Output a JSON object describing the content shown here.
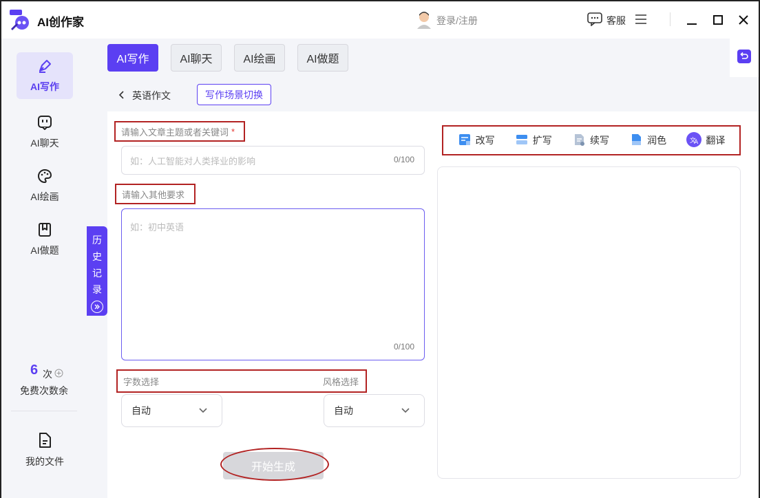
{
  "app": {
    "title": "AI创作家",
    "login": "登录/注册",
    "service": "客服"
  },
  "colors": {
    "accent": "#5b3ff2",
    "highlight": "#b22222"
  },
  "sidebar": {
    "items": [
      {
        "label": "AI写作",
        "icon": "pen-icon",
        "active": true
      },
      {
        "label": "AI聊天",
        "icon": "chat-bot-icon"
      },
      {
        "label": "AI绘画",
        "icon": "palette-icon"
      },
      {
        "label": "AI做题",
        "icon": "bookmark-book-icon"
      }
    ],
    "free_count": "6",
    "free_unit": "次",
    "free_label": "免费次数余",
    "my_files": "我的文件"
  },
  "tabs": [
    "AI写作",
    "AI聊天",
    "AI绘画",
    "AI做题"
  ],
  "crumb": {
    "back": "英语作文",
    "switch": "写作场景切换"
  },
  "history": [
    "历",
    "史",
    "记",
    "录"
  ],
  "form": {
    "topic_label": "请输入文章主题或者关键词",
    "required_mark": "*",
    "topic_placeholder": "如：人工智能对人类择业的影响",
    "topic_counter": "0/100",
    "other_label": "请输入其他要求",
    "other_placeholder": "如：初中英语",
    "other_counter": "0/100",
    "word_label": "字数选择",
    "style_label": "风格选择",
    "word_value": "自动",
    "style_value": "自动",
    "generate": "开始生成"
  },
  "tools": [
    {
      "label": "改写",
      "icon": "rewrite-icon"
    },
    {
      "label": "扩写",
      "icon": "expand-icon"
    },
    {
      "label": "续写",
      "icon": "continue-icon"
    },
    {
      "label": "润色",
      "icon": "polish-icon"
    },
    {
      "label": "翻译",
      "icon": "translate-icon"
    }
  ]
}
